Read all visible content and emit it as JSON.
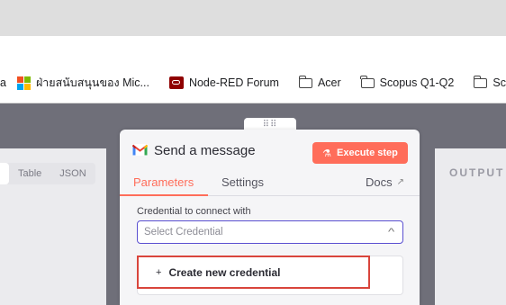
{
  "bookmarks": [
    {
      "label": "a",
      "icon": "none"
    },
    {
      "label": "ฝ่ายสนับสนุนของ Mic...",
      "icon": "microsoft-logo"
    },
    {
      "label": "Node-RED Forum",
      "icon": "node-red-logo"
    },
    {
      "label": "Acer",
      "icon": "folder-icon"
    },
    {
      "label": "Scopus Q1-Q2",
      "icon": "folder-icon"
    },
    {
      "label": "Scopu",
      "icon": "folder-icon"
    }
  ],
  "input_panel": {
    "view_modes": [
      "Table",
      "JSON"
    ]
  },
  "output_panel": {
    "label": "OUTPUT"
  },
  "node": {
    "title": "Send a message",
    "icon": "gmail-icon",
    "execute_label": "Execute step",
    "accent_color": "#ff6d5a",
    "tabs": {
      "parameters": "Parameters",
      "settings": "Settings",
      "docs": "Docs"
    },
    "credential": {
      "label": "Credential to connect with",
      "placeholder": "Select Credential",
      "create_option": "Create new credential"
    }
  }
}
